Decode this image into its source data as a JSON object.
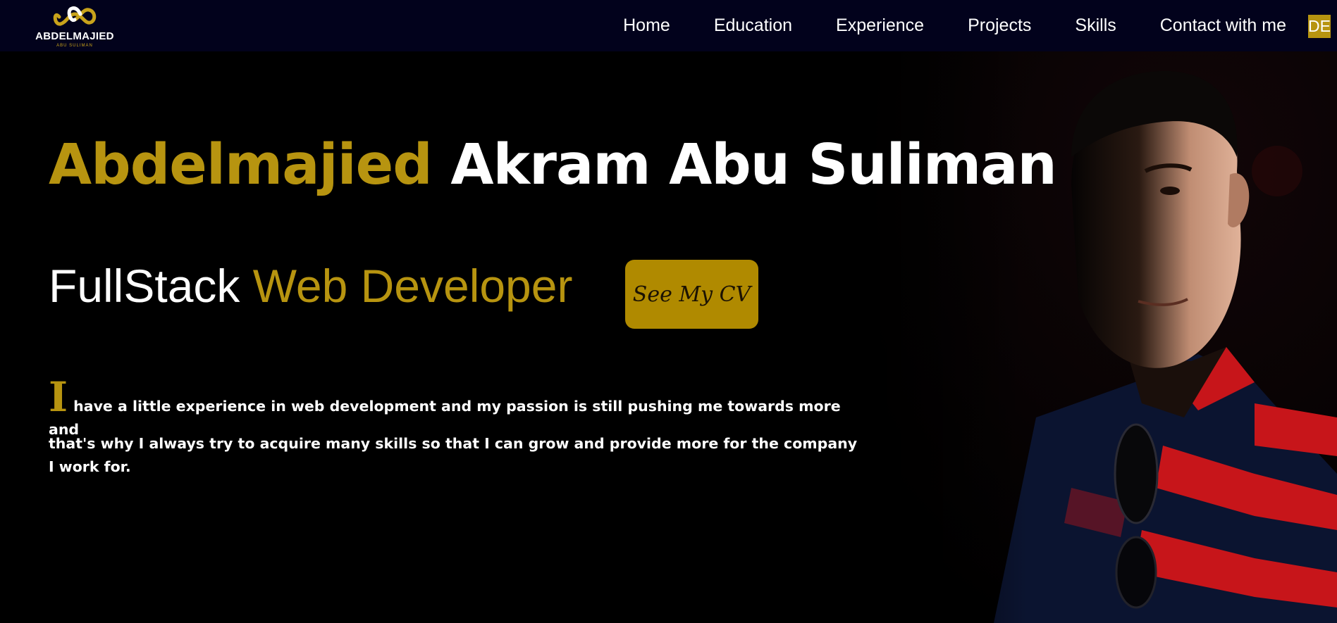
{
  "brand": {
    "name": "ABDELMAJIED",
    "sub": "ABU SULIMAN"
  },
  "nav": {
    "items": [
      "Home",
      "Education",
      "Experience",
      "Projects",
      "Skills",
      "Contact with me"
    ],
    "lang": "DE"
  },
  "hero": {
    "first_name": "Abdelmajied",
    "rest_name": "Akram Abu Suliman",
    "role_white": "FullStack",
    "role_gold": "Web Developer",
    "cv_button": "See My CV",
    "about_initial": "I",
    "about_line1": "have a little experience in web development and my passion is still pushing me towards more and",
    "about_line2": "that's why I always try to acquire many skills so that I can grow and provide more for the company I work for."
  },
  "colors": {
    "navbar_bg": "#02021c",
    "accent_gold": "#b79410",
    "button_gold": "#b08a00",
    "page_bg": "#000000"
  },
  "icons": [
    "infinity-logo-icon"
  ]
}
